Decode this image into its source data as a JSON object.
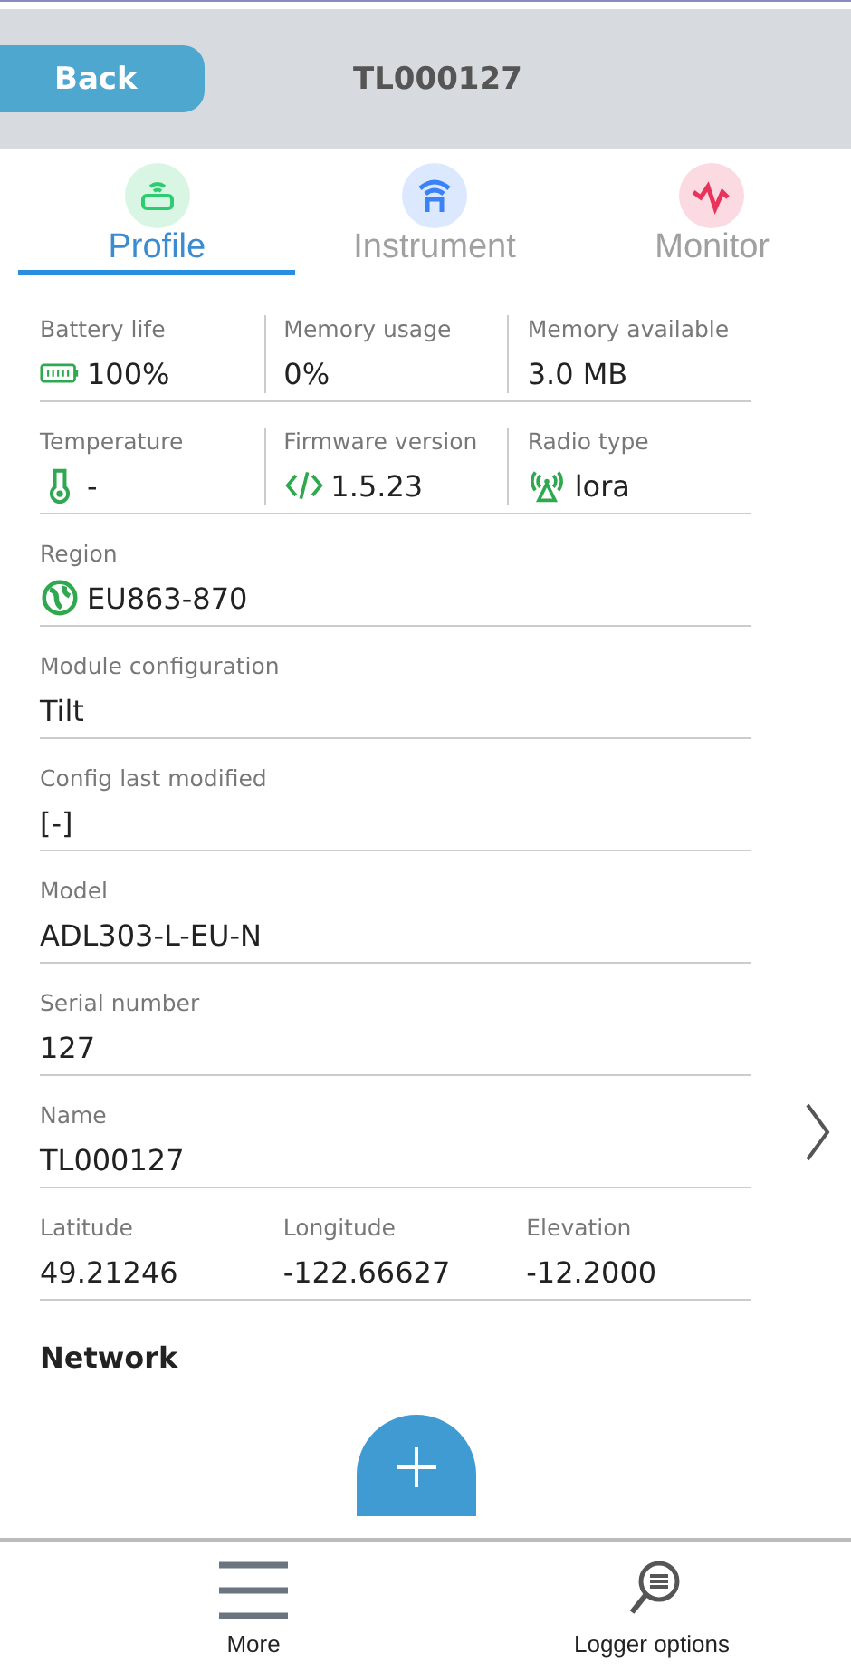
{
  "header": {
    "back": "Back",
    "title": "TL000127"
  },
  "tabs": [
    {
      "label": "Profile",
      "selected": true,
      "kind": "router"
    },
    {
      "label": "Instrument",
      "selected": false,
      "kind": "antenna"
    },
    {
      "label": "Monitor",
      "selected": false,
      "kind": "pulse"
    }
  ],
  "rows": [
    {
      "dividers": true,
      "cells": [
        {
          "label": "Battery life",
          "value": "100%",
          "kind": "battery"
        },
        {
          "label": "Memory usage",
          "value": "0%"
        },
        {
          "label": "Memory available",
          "value": "3.0 MB"
        }
      ]
    },
    {
      "dividers": true,
      "cells": [
        {
          "label": "Temperature",
          "value": "-",
          "kind": "thermo"
        },
        {
          "label": "Firmware version",
          "value": "1.5.23",
          "kind": "code"
        },
        {
          "label": "Radio type",
          "value": "lora",
          "kind": "radio"
        }
      ]
    },
    {
      "cells": [
        {
          "label": "Region",
          "value": "EU863-870",
          "kind": "globe"
        }
      ]
    },
    {
      "cells": [
        {
          "label": "Module configuration",
          "value": "Tilt"
        }
      ]
    },
    {
      "cells": [
        {
          "label": "Config last modified",
          "value": "[-]"
        }
      ]
    },
    {
      "cells": [
        {
          "label": "Model",
          "value": "ADL303-L-EU-N"
        }
      ]
    },
    {
      "cells": [
        {
          "label": "Serial number",
          "value": "127"
        }
      ]
    },
    {
      "cells": [
        {
          "label": "Name",
          "value": "TL000127"
        }
      ],
      "chevron": true
    },
    {
      "dividers": false,
      "cells": [
        {
          "label": "Latitude",
          "value": "49.21246"
        },
        {
          "label": "Longitude",
          "value": "-122.66627"
        },
        {
          "label": "Elevation",
          "value": "-12.2000"
        }
      ]
    }
  ],
  "section": "Network",
  "nav": [
    {
      "label": "More",
      "kind": "menu"
    },
    {
      "label": "Logger options",
      "kind": "logger"
    }
  ]
}
